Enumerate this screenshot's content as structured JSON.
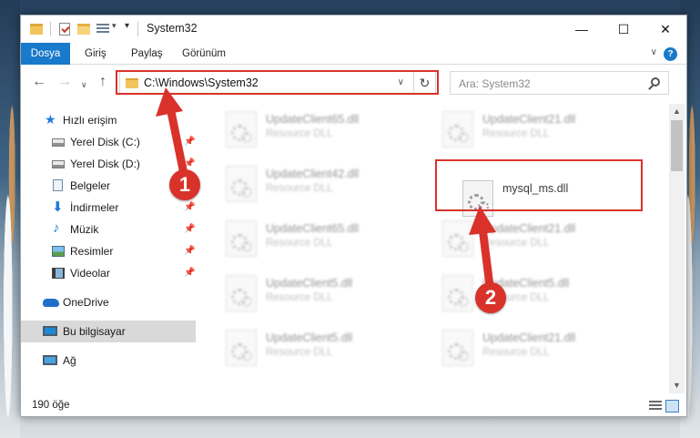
{
  "window": {
    "title": "System32",
    "controls": {
      "minimize": "—",
      "maximize": "☐",
      "close": "✕"
    }
  },
  "ribbon": {
    "tabs": [
      "Dosya",
      "Giriş",
      "Paylaş",
      "Görünüm"
    ]
  },
  "navigation": {
    "back": "←",
    "forward": "→",
    "recent": "∨",
    "up": "↑",
    "address": "C:\\Windows\\System32",
    "refresh": "↻",
    "search_placeholder": "Ara: System32"
  },
  "sidebar": {
    "items": [
      {
        "label": "Hızlı erişim",
        "icon": "star-icon",
        "pinned": false
      },
      {
        "label": "Yerel Disk (C:)",
        "icon": "drive-icon",
        "pinned": true
      },
      {
        "label": "Yerel Disk (D:)",
        "icon": "drive-icon",
        "pinned": true
      },
      {
        "label": "Belgeler",
        "icon": "documents-icon",
        "pinned": true
      },
      {
        "label": "İndirmeler",
        "icon": "downloads-icon",
        "pinned": true
      },
      {
        "label": "Müzik",
        "icon": "music-icon",
        "pinned": true
      },
      {
        "label": "Resimler",
        "icon": "pictures-icon",
        "pinned": true
      },
      {
        "label": "Videolar",
        "icon": "videos-icon",
        "pinned": true
      },
      {
        "label": "OneDrive",
        "icon": "cloud-icon",
        "pinned": false
      },
      {
        "label": "Bu bilgisayar",
        "icon": "computer-icon",
        "pinned": false,
        "selected": true
      },
      {
        "label": "Ağ",
        "icon": "network-icon",
        "pinned": false
      }
    ],
    "pin_glyph": "📌"
  },
  "files": {
    "left": [
      {
        "name": "UpdateClient65.dll",
        "type": "Resource DLL"
      },
      {
        "name": "UpdateClient42.dll",
        "type": "Resource DLL"
      },
      {
        "name": "UpdateClient65.dll",
        "type": "Resource DLL"
      },
      {
        "name": "UpdateClient5.dll",
        "type": "Resource DLL"
      },
      {
        "name": "UpdateClient5.dll",
        "type": "Resource DLL"
      }
    ],
    "right": [
      {
        "name": "UpdateClient21.dll",
        "type": "Resource DLL"
      },
      {
        "name": "mysql_ms.dll",
        "type": ""
      },
      {
        "name": "UpdateClient21.dll",
        "type": "Resource DLL"
      },
      {
        "name": "UpdateClient5.dll",
        "type": "Resource DLL"
      },
      {
        "name": "UpdateClient21.dll",
        "type": "Resource DLL"
      }
    ]
  },
  "status": {
    "item_count": "190 öğe"
  },
  "annotations": {
    "marker_1": "1",
    "marker_2": "2",
    "color": "#d9322b"
  }
}
